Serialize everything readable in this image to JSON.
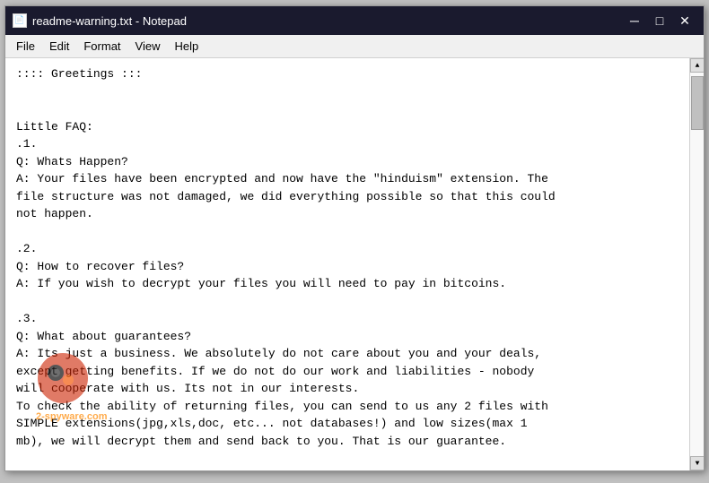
{
  "window": {
    "title": "readme-warning.txt - Notepad",
    "icon": "📄"
  },
  "titlebar": {
    "minimize_label": "─",
    "maximize_label": "□",
    "close_label": "✕"
  },
  "menubar": {
    "items": [
      "File",
      "Edit",
      "Format",
      "View",
      "Help"
    ]
  },
  "content": {
    "text": ":::: Greetings :::\n\n\nLittle FAQ:\n.1.\nQ: Whats Happen?\nA: Your files have been encrypted and now have the \"hinduism\" extension. The\nfile structure was not damaged, we did everything possible so that this could\nnot happen.\n\n.2.\nQ: How to recover files?\nA: If you wish to decrypt your files you will need to pay in bitcoins.\n\n.3.\nQ: What about guarantees?\nA: Its just a business. We absolutely do not care about you and your deals,\nexcept getting benefits. If we do not do our work and liabilities - nobody\nwill cooperate with us. Its not in our interests.\nTo check the ability of returning files, you can send to us any 2 files with\nSIMPLE extensions(jpg,xls,doc, etc... not databases!) and low sizes(max 1\nmb), we will decrypt them and send back to you. That is our guarantee."
  },
  "watermark": {
    "text": "2-spyware.com"
  }
}
